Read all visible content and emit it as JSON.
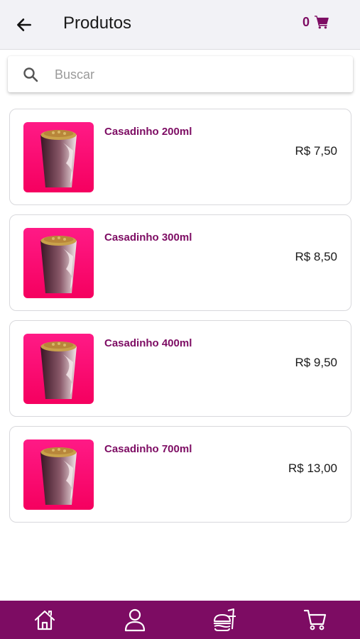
{
  "colors": {
    "brand": "#7d0c63",
    "header_bg": "#f2f2f6",
    "thumb_pink": "#ff1a7d"
  },
  "header": {
    "title": "Produtos",
    "cart_count": "0",
    "back_icon": "arrow-left-icon",
    "cart_icon": "cart-icon"
  },
  "search": {
    "placeholder": "Buscar",
    "value": "",
    "icon": "search-icon"
  },
  "products": [
    {
      "name": "Casadinho 200ml",
      "price": "R$ 7,50"
    },
    {
      "name": "Casadinho 300ml",
      "price": "R$ 8,50"
    },
    {
      "name": "Casadinho 400ml",
      "price": "R$ 9,50"
    },
    {
      "name": "Casadinho 700ml",
      "price": "R$ 13,00"
    }
  ],
  "bottom_nav": [
    "home-icon",
    "user-icon",
    "food-icon",
    "cart-icon"
  ]
}
